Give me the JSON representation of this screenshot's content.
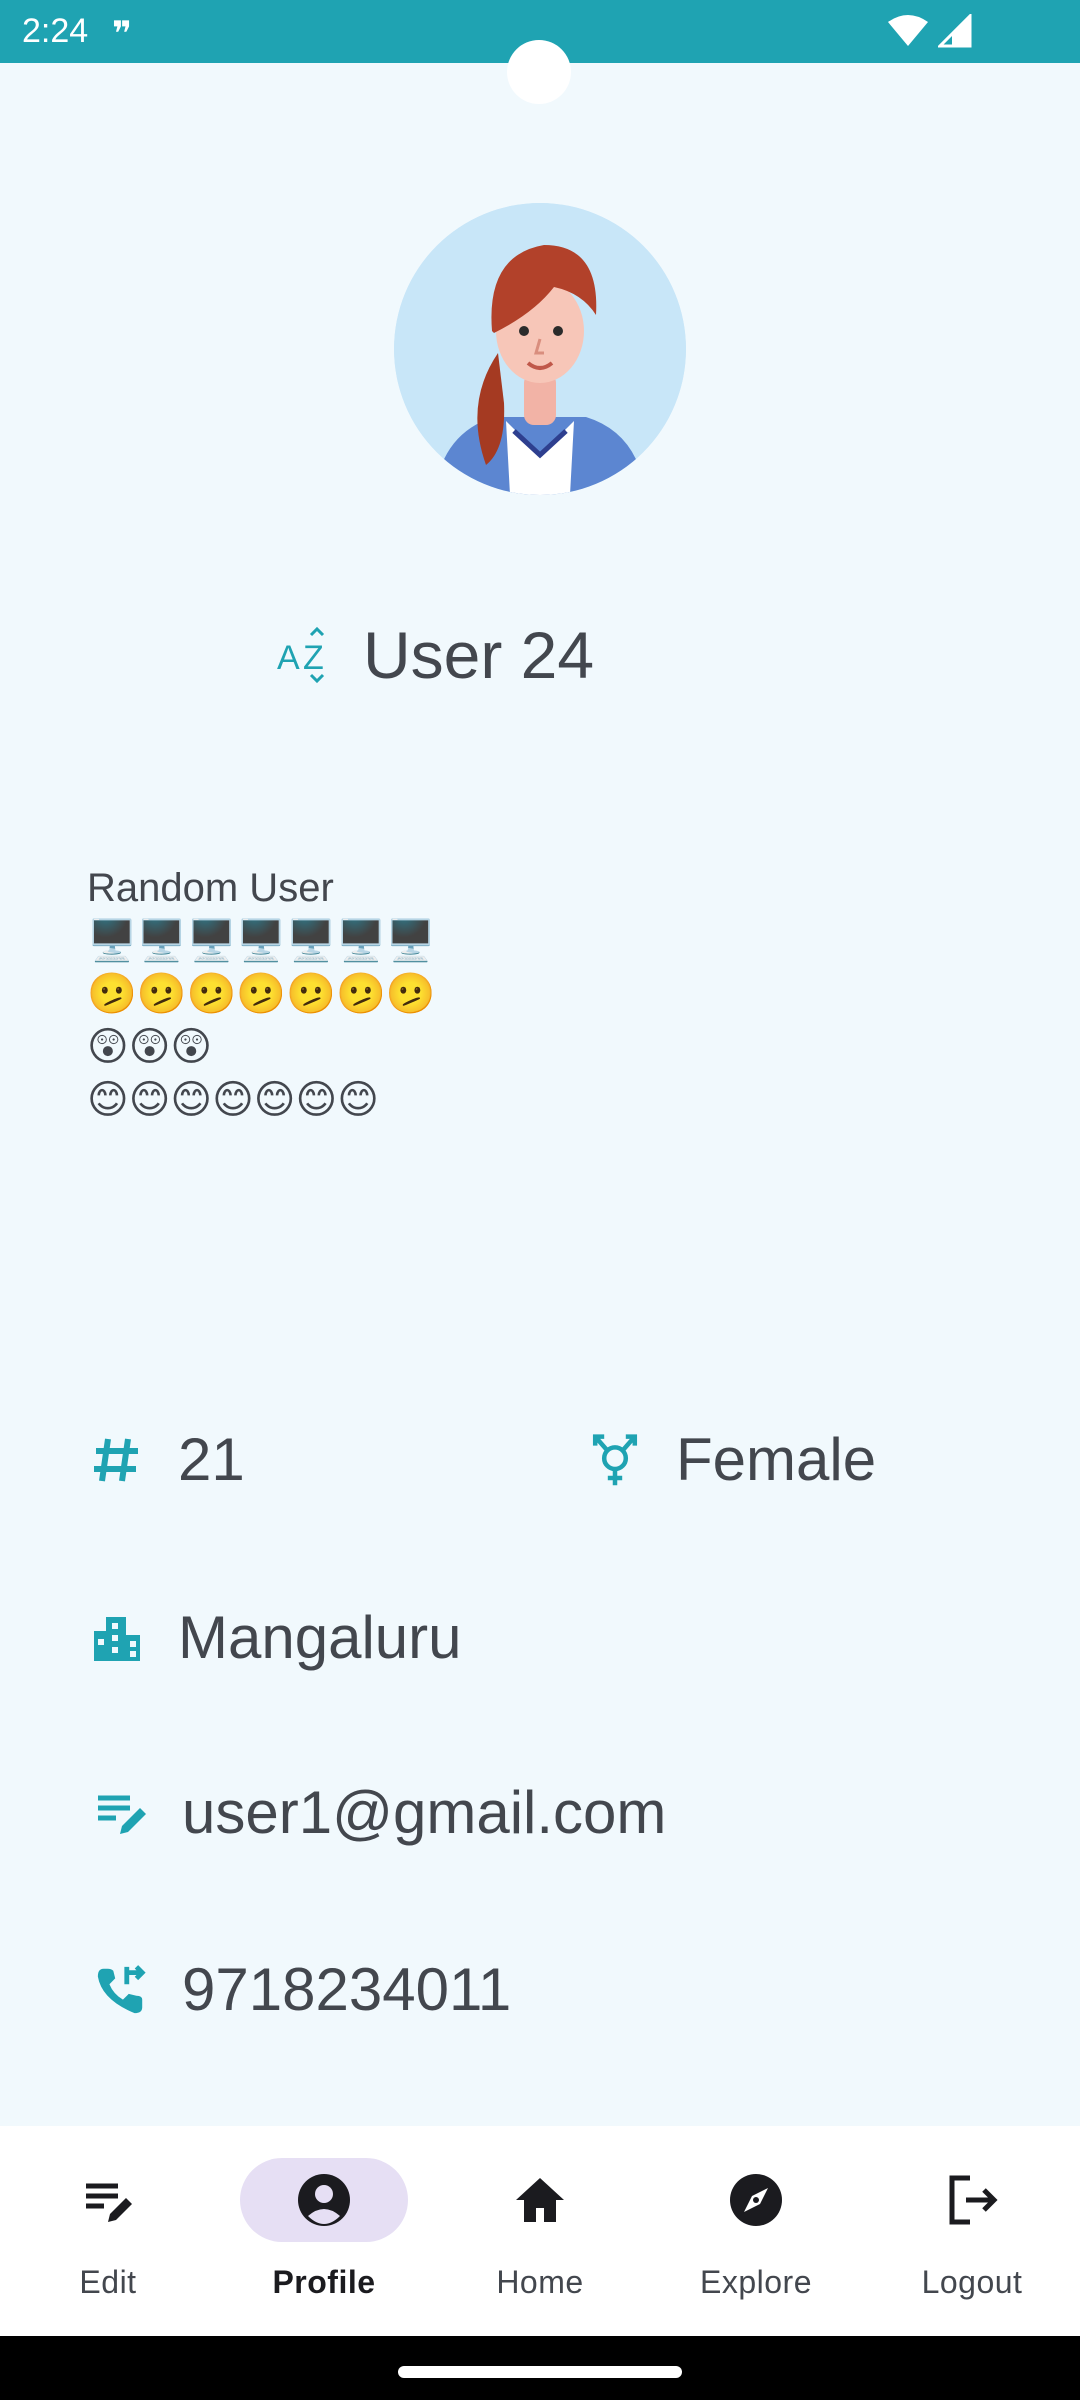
{
  "status_bar": {
    "time": "2:24",
    "notification": "❞"
  },
  "profile": {
    "name": "User 24",
    "bio": "Random User\n🖥️🖥️🖥️🖥️🖥️🖥️🖥️\n🫤🫤🫤🫤🫤🫤🫤\n😲😲😲\n😊😊😊😊😊😊😊",
    "age": "21",
    "gender": "Female",
    "city": "Mangaluru",
    "email": "user1@gmail.com",
    "phone": "9718234011"
  },
  "nav": [
    {
      "label": "Edit",
      "icon": "edit-icon",
      "active": false
    },
    {
      "label": "Profile",
      "icon": "account-circle-icon",
      "active": true
    },
    {
      "label": "Home",
      "icon": "home-icon",
      "active": false
    },
    {
      "label": "Explore",
      "icon": "compass-icon",
      "active": false
    },
    {
      "label": "Logout",
      "icon": "logout-icon",
      "active": false
    }
  ],
  "colors": {
    "accent": "#1FA3B2",
    "background": "#F1F9FD",
    "active_pill": "#E6DFF4",
    "text": "#43474E"
  }
}
